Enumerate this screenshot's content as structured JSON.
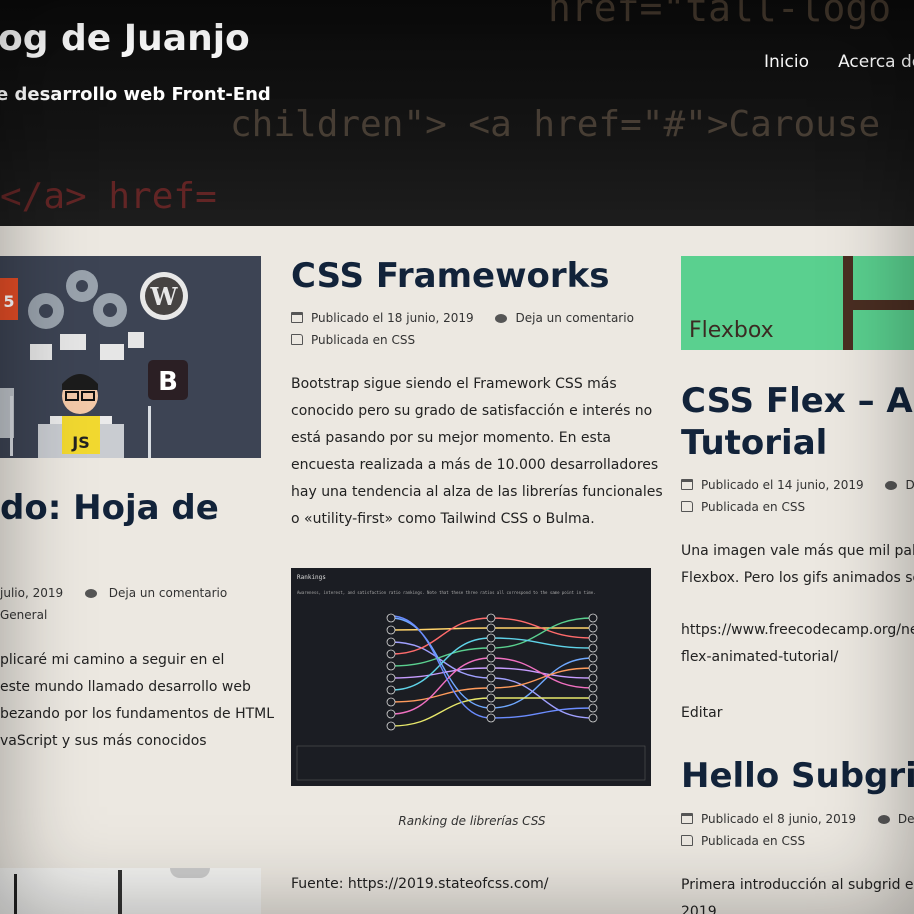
{
  "header": {
    "site_title": "og de Juanjo",
    "site_description": "e desarrollo web Front-End",
    "menu": [
      "Inicio",
      "Acerca de"
    ],
    "bg_code_lines": [
      "href=\"tall-logo",
      "children\"> <a href=\"#\">Carouse",
      "</a> href="
    ]
  },
  "post_left": {
    "title": "do: Hoja de",
    "meta_date": "julio, 2019",
    "meta_comment": "Deja un comentario",
    "meta_category": "General",
    "excerpt": [
      "plicaré mi camino a seguir en el",
      " este mundo llamado desarrollo web",
      "bezando por los fundamentos de HTML",
      "vaScript y sus más conocidos"
    ],
    "image_labels": {
      "js": "JS",
      "bootstrap": "B",
      "html5": "5"
    }
  },
  "post_center": {
    "title": "CSS Frameworks",
    "meta_date": "Publicado el 18 junio, 2019",
    "meta_comment": "Deja un comentario",
    "meta_category": "Publicada en CSS",
    "excerpt": [
      "Bootstrap sigue siendo el Framework CSS más",
      "conocido pero su grado de satisfacción e interés no",
      "está pasando por su mejor momento. En esta",
      "encuesta realizada a más de 10.000 desarrolladores",
      "hay una tendencia al alza de las librerías funcionales",
      "o «utility-first» como Tailwind CSS o Bulma."
    ],
    "ranking_title": "Rankings",
    "ranking_subtitle": "Awareness, interest, and satisfaction ratio rankings. Note that these three ratios all correspond to the same point in time.",
    "caption": "Ranking de librerías CSS",
    "source": "Fuente: https://2019.stateofcss.com/"
  },
  "post_right_1": {
    "image_text": "Flexbox",
    "title_line1": "CSS Flex – An",
    "title_line2": "Tutorial",
    "meta_date": "Publicado el 14 junio, 2019",
    "meta_comment": "Deja",
    "meta_category": "Publicada en CSS",
    "excerpt": [
      "Una imagen vale más que mil palab",
      "Flexbox. Pero los gifs animados son"
    ],
    "link": [
      "https://www.freecodecamp.org/ne",
      "flex-animated-tutorial/"
    ],
    "edit": "Editar"
  },
  "post_right_2": {
    "title": "Hello Subgrid",
    "meta_date": "Publicado el 8 junio, 2019",
    "meta_comment": "Deja u",
    "meta_category": "Publicada en CSS",
    "excerpt": [
      "Primera introducción al subgrid en",
      "2019"
    ]
  },
  "colors": {
    "title": "#12233a",
    "flexbox_green": "#5ad08f",
    "js_yellow": "#f2d930"
  }
}
